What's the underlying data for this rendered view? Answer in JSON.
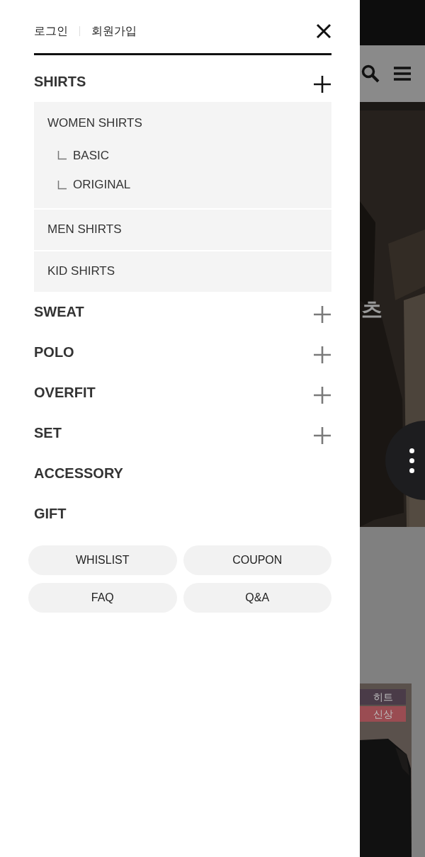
{
  "drawer": {
    "auth_links": [
      "로그인",
      "회원가입"
    ],
    "categories": [
      {
        "label": "SHIRTS",
        "expanded": true,
        "children": [
          {
            "label": "WOMEN SHIRTS",
            "children": [
              {
                "label": "BASIC"
              },
              {
                "label": "ORIGINAL"
              }
            ]
          },
          {
            "label": "MEN SHIRTS"
          },
          {
            "label": "KID SHIRTS"
          }
        ]
      },
      {
        "label": "SWEAT",
        "expanded": false
      },
      {
        "label": "POLO",
        "expanded": false
      },
      {
        "label": "OVERFIT",
        "expanded": false
      },
      {
        "label": "SET",
        "expanded": false
      },
      {
        "label": "ACCESSORY"
      },
      {
        "label": "GIFT"
      }
    ],
    "buttons": [
      "WHISLIST",
      "COUPON",
      "FAQ",
      "Q&A"
    ]
  },
  "background_page": {
    "banner_text": "츠",
    "product_badges": [
      {
        "label": "히트",
        "color": "#4a3b48"
      },
      {
        "label": "신상",
        "color": "#9a4c52"
      }
    ]
  }
}
